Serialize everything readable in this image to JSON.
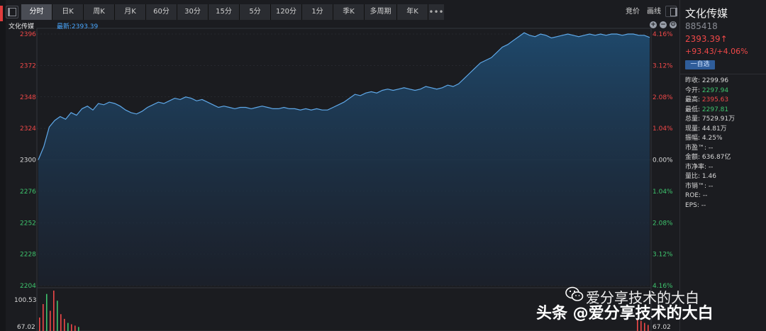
{
  "toolbar": {
    "tabs": [
      "分时",
      "日K",
      "周K",
      "月K",
      "60分",
      "30分",
      "15分",
      "5分",
      "120分",
      "1分",
      "季K",
      "多周期",
      "年K"
    ],
    "tab_widths": [
      44,
      44,
      44,
      44,
      44,
      44,
      44,
      44,
      44,
      44,
      44,
      46,
      44
    ],
    "active_index": 0,
    "more": "•••",
    "right_buttons": [
      "竞价",
      "画线"
    ]
  },
  "chart": {
    "title": "文化传媒",
    "latest_label": "最新:2393.39",
    "zoom_buttons": [
      "+",
      "−",
      "⚙"
    ],
    "price_ticks": [
      "2396",
      "2372",
      "2348",
      "2324",
      "2300",
      "2276",
      "2252",
      "2228",
      "2204"
    ],
    "pct_ticks": [
      "4.16%",
      "3.12%",
      "2.08%",
      "1.04%",
      "0.00%",
      "1.04%",
      "2.08%",
      "3.12%",
      "4.16%"
    ],
    "volume_ticks": [
      "100.53",
      "67.02"
    ],
    "volume_right_tick": "67.02",
    "colors": {
      "line": "#5fa8e8",
      "up": "#f04848",
      "down": "#3ec46d",
      "neutral": "#d8d8d8",
      "area_top": "#1f4a6e",
      "area_bottom": "#1b2230",
      "grid": "#33363d"
    }
  },
  "chart_data": {
    "type": "area",
    "title": "文化传媒",
    "xlabel": "",
    "ylabel": "",
    "ylim": [
      2204,
      2396
    ],
    "baseline": 2299.96,
    "series": [
      {
        "name": "文化传媒",
        "values": [
          2300,
          2310,
          2325,
          2330,
          2333,
          2331,
          2336,
          2334,
          2339,
          2341,
          2338,
          2343,
          2342,
          2344,
          2343,
          2341,
          2338,
          2336,
          2335,
          2337,
          2340,
          2342,
          2344,
          2343,
          2345,
          2347,
          2346,
          2348,
          2347,
          2345,
          2346,
          2344,
          2342,
          2340,
          2341,
          2340,
          2339,
          2340,
          2340,
          2339,
          2340,
          2341,
          2340,
          2339,
          2339,
          2340,
          2339,
          2339,
          2338,
          2339,
          2338,
          2339,
          2338,
          2338,
          2340,
          2342,
          2344,
          2347,
          2350,
          2349,
          2351,
          2352,
          2351,
          2353,
          2354,
          2353,
          2354,
          2355,
          2354,
          2353,
          2354,
          2356,
          2355,
          2354,
          2355,
          2357,
          2356,
          2358,
          2362,
          2366,
          2370,
          2374,
          2376,
          2378,
          2382,
          2386,
          2388,
          2391,
          2394,
          2397,
          2395,
          2394,
          2396,
          2395,
          2393,
          2394,
          2395,
          2396,
          2395,
          2394,
          2395,
          2396,
          2395,
          2396,
          2395,
          2396,
          2396,
          2395,
          2396,
          2396,
          2395,
          2395,
          2393.39
        ]
      }
    ],
    "volume": [
      20,
      40,
      55,
      30,
      60,
      45,
      25,
      18,
      12,
      10,
      8,
      6
    ],
    "volume_tail": [
      6,
      5,
      4,
      3
    ]
  },
  "panel": {
    "name": "文化传媒",
    "code": "885418",
    "price": "2393.39↑",
    "change": "+93.43/+4.06%",
    "watch_button": "一自选",
    "stats": [
      {
        "label": "昨收: ",
        "value": "2299.96",
        "tone": "neutral"
      },
      {
        "label": "今开: ",
        "value": "2297.94",
        "tone": "down"
      },
      {
        "label": "最高: ",
        "value": "2395.63",
        "tone": "up"
      },
      {
        "label": "最低: ",
        "value": "2297.81",
        "tone": "down"
      },
      {
        "label": "总量: ",
        "value": "7529.91万",
        "tone": "neutral"
      },
      {
        "label": "现量: ",
        "value": "44.81万",
        "tone": "neutral"
      },
      {
        "label": "振幅: ",
        "value": "4.25%",
        "tone": "neutral"
      },
      {
        "label": "市盈™: ",
        "value": "--",
        "tone": "neutral"
      },
      {
        "label": "金额: ",
        "value": "636.87亿",
        "tone": "neutral"
      },
      {
        "label": "市净率: ",
        "value": "--",
        "tone": "neutral"
      },
      {
        "label": "量比: ",
        "value": "1.46",
        "tone": "neutral"
      },
      {
        "label": "市销™: ",
        "value": "--",
        "tone": "neutral"
      },
      {
        "label": "ROE: ",
        "value": "--",
        "tone": "neutral"
      },
      {
        "label": "EPS: ",
        "value": "--",
        "tone": "neutral"
      }
    ]
  },
  "watermark": {
    "line1": "爱分享技术的大白",
    "line2": "头条 @爱分享技术的大白"
  }
}
